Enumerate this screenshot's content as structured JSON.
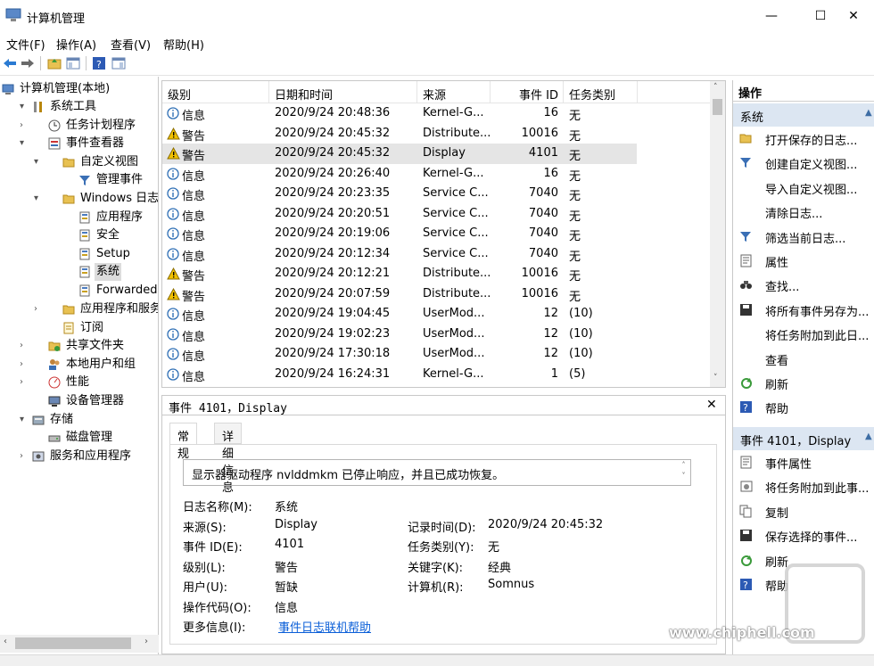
{
  "window": {
    "title": "计算机管理"
  },
  "menu": [
    "文件(F)",
    "操作(A)",
    "查看(V)",
    "帮助(H)"
  ],
  "tree": [
    {
      "label": "计算机管理(本地)",
      "level": 0,
      "arrow": "",
      "icon": "computer-icon"
    },
    {
      "label": "系统工具",
      "level": 1,
      "arrow": "▾",
      "icon": "tools-icon"
    },
    {
      "label": "任务计划程序",
      "level": 2,
      "arrow": "›",
      "icon": "clock-icon"
    },
    {
      "label": "事件查看器",
      "level": 2,
      "arrow": "▾",
      "icon": "event-viewer-icon"
    },
    {
      "label": "自定义视图",
      "level": 3,
      "arrow": "▾",
      "icon": "folder-icon"
    },
    {
      "label": "管理事件",
      "level": 4,
      "arrow": "",
      "icon": "filter-icon"
    },
    {
      "label": "Windows 日志",
      "level": 3,
      "arrow": "▾",
      "icon": "folder-icon"
    },
    {
      "label": "应用程序",
      "level": 4,
      "arrow": "",
      "icon": "log-icon"
    },
    {
      "label": "安全",
      "level": 4,
      "arrow": "",
      "icon": "log-icon"
    },
    {
      "label": "Setup",
      "level": 4,
      "arrow": "",
      "icon": "log-icon"
    },
    {
      "label": "系统",
      "level": 4,
      "arrow": "",
      "icon": "log-icon",
      "selected": true
    },
    {
      "label": "Forwarded Ev",
      "level": 4,
      "arrow": "",
      "icon": "log-icon"
    },
    {
      "label": "应用程序和服务日",
      "level": 3,
      "arrow": "›",
      "icon": "folder-icon"
    },
    {
      "label": "订阅",
      "level": 3,
      "arrow": "",
      "icon": "subscription-icon"
    },
    {
      "label": "共享文件夹",
      "level": 2,
      "arrow": "›",
      "icon": "shared-folder-icon"
    },
    {
      "label": "本地用户和组",
      "level": 2,
      "arrow": "›",
      "icon": "users-icon"
    },
    {
      "label": "性能",
      "level": 2,
      "arrow": "›",
      "icon": "performance-icon"
    },
    {
      "label": "设备管理器",
      "level": 2,
      "arrow": "",
      "icon": "device-manager-icon"
    },
    {
      "label": "存储",
      "level": 1,
      "arrow": "▾",
      "icon": "storage-icon"
    },
    {
      "label": "磁盘管理",
      "level": 2,
      "arrow": "",
      "icon": "disk-icon"
    },
    {
      "label": "服务和应用程序",
      "level": 1,
      "arrow": "›",
      "icon": "services-icon"
    }
  ],
  "events": {
    "columns": [
      "级别",
      "日期和时间",
      "来源",
      "事件 ID",
      "任务类别"
    ],
    "rows": [
      {
        "level": "信息",
        "type": "info",
        "date": "2020/9/24 20:48:36",
        "source": "Kernel-G...",
        "id": "16",
        "cat": "无"
      },
      {
        "level": "警告",
        "type": "warn",
        "date": "2020/9/24 20:45:32",
        "source": "Distribute...",
        "id": "10016",
        "cat": "无"
      },
      {
        "level": "警告",
        "type": "warn",
        "date": "2020/9/24 20:45:32",
        "source": "Display",
        "id": "4101",
        "cat": "无",
        "selected": true
      },
      {
        "level": "信息",
        "type": "info",
        "date": "2020/9/24 20:26:40",
        "source": "Kernel-G...",
        "id": "16",
        "cat": "无"
      },
      {
        "level": "信息",
        "type": "info",
        "date": "2020/9/24 20:23:35",
        "source": "Service C...",
        "id": "7040",
        "cat": "无"
      },
      {
        "level": "信息",
        "type": "info",
        "date": "2020/9/24 20:20:51",
        "source": "Service C...",
        "id": "7040",
        "cat": "无"
      },
      {
        "level": "信息",
        "type": "info",
        "date": "2020/9/24 20:19:06",
        "source": "Service C...",
        "id": "7040",
        "cat": "无"
      },
      {
        "level": "信息",
        "type": "info",
        "date": "2020/9/24 20:12:34",
        "source": "Service C...",
        "id": "7040",
        "cat": "无"
      },
      {
        "level": "警告",
        "type": "warn",
        "date": "2020/9/24 20:12:21",
        "source": "Distribute...",
        "id": "10016",
        "cat": "无"
      },
      {
        "level": "警告",
        "type": "warn",
        "date": "2020/9/24 20:07:59",
        "source": "Distribute...",
        "id": "10016",
        "cat": "无"
      },
      {
        "level": "信息",
        "type": "info",
        "date": "2020/9/24 19:04:45",
        "source": "UserMod...",
        "id": "12",
        "cat": "(10)"
      },
      {
        "level": "信息",
        "type": "info",
        "date": "2020/9/24 19:02:23",
        "source": "UserMod...",
        "id": "12",
        "cat": "(10)"
      },
      {
        "level": "信息",
        "type": "info",
        "date": "2020/9/24 17:30:18",
        "source": "UserMod...",
        "id": "12",
        "cat": "(10)"
      },
      {
        "level": "信息",
        "type": "info",
        "date": "2020/9/24 16:24:31",
        "source": "Kernel-G...",
        "id": "1",
        "cat": "(5)"
      }
    ]
  },
  "detail": {
    "title": "事件 4101，Display",
    "tabs": [
      "常规",
      "详细信息"
    ],
    "message": "显示器驱动程序 nvlddmkm 已停止响应，并且已成功恢复。",
    "fields": {
      "log_name_label": "日志名称(M):",
      "log_name": "系统",
      "source_label": "来源(S):",
      "source": "Display",
      "logged_label": "记录时间(D):",
      "logged": "2020/9/24 20:45:32",
      "id_label": "事件 ID(E):",
      "id": "4101",
      "task_label": "任务类别(Y):",
      "task": "无",
      "level_label": "级别(L):",
      "level": "警告",
      "keywords_label": "关键字(K):",
      "keywords": "经典",
      "user_label": "用户(U):",
      "user": "暂缺",
      "computer_label": "计算机(R):",
      "computer": "Somnus",
      "opcode_label": "操作代码(O):",
      "opcode": "信息",
      "more_label": "更多信息(I):",
      "more_link": "事件日志联机帮助"
    }
  },
  "actions": {
    "header": "操作",
    "group1": "系统",
    "items1": [
      {
        "label": "打开保存的日志...",
        "icon": "open-folder-icon"
      },
      {
        "label": "创建自定义视图...",
        "icon": "filter-icon"
      },
      {
        "label": "导入自定义视图...",
        "icon": ""
      },
      {
        "label": "清除日志...",
        "icon": ""
      },
      {
        "label": "筛选当前日志...",
        "icon": "filter-icon"
      },
      {
        "label": "属性",
        "icon": "properties-icon"
      },
      {
        "label": "查找...",
        "icon": "binoculars-icon"
      },
      {
        "label": "将所有事件另存为...",
        "icon": "save-icon"
      },
      {
        "label": "将任务附加到此日...",
        "icon": ""
      },
      {
        "label": "查看",
        "icon": ""
      },
      {
        "label": "刷新",
        "icon": "refresh-icon"
      },
      {
        "label": "帮助",
        "icon": "help-icon"
      }
    ],
    "group2": "事件 4101，Display",
    "items2": [
      {
        "label": "事件属性",
        "icon": "properties-icon"
      },
      {
        "label": "将任务附加到此事...",
        "icon": "task-icon"
      },
      {
        "label": "复制",
        "icon": "copy-icon"
      },
      {
        "label": "保存选择的事件...",
        "icon": "save-icon"
      },
      {
        "label": "刷新",
        "icon": "refresh-icon"
      },
      {
        "label": "帮助",
        "icon": "help-icon"
      }
    ]
  },
  "watermark": "www.chiphell.com",
  "colors": {
    "link": "#0b5fd8",
    "action_group": "#dce6f2",
    "warn": "#f2c200",
    "info": "#2f6fb5"
  }
}
